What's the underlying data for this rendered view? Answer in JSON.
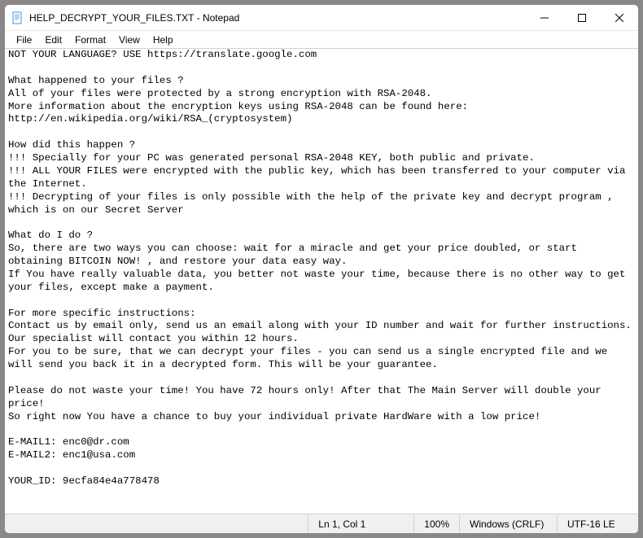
{
  "titlebar": {
    "title": "HELP_DECRYPT_YOUR_FILES.TXT - Notepad"
  },
  "menubar": {
    "items": [
      "File",
      "Edit",
      "Format",
      "View",
      "Help"
    ]
  },
  "content": {
    "text": "NOT YOUR LANGUAGE? USE https://translate.google.com\n\nWhat happened to your files ?\nAll of your files were protected by a strong encryption with RSA-2048.\nMore information about the encryption keys using RSA-2048 can be found here: http://en.wikipedia.org/wiki/RSA_(cryptosystem)\n\nHow did this happen ?\n!!! Specially for your PC was generated personal RSA-2048 KEY, both public and private.\n!!! ALL YOUR FILES were encrypted with the public key, which has been transferred to your computer via the Internet.\n!!! Decrypting of your files is only possible with the help of the private key and decrypt program , which is on our Secret Server\n\nWhat do I do ?\nSo, there are two ways you can choose: wait for a miracle and get your price doubled, or start obtaining BITCOIN NOW! , and restore your data easy way.\nIf You have really valuable data, you better not waste your time, because there is no other way to get your files, except make a payment.\n\nFor more specific instructions:\nContact us by email only, send us an email along with your ID number and wait for further instructions. Our specialist will contact you within 12 hours.\nFor you to be sure, that we can decrypt your files - you can send us a single encrypted file and we will send you back it in a decrypted form. This will be your guarantee.\n\nPlease do not waste your time! You have 72 hours only! After that The Main Server will double your price!\nSo right now You have a chance to buy your individual private HardWare with a low price!\n\nE-MAIL1: enc0@dr.com\nE-MAIL2: enc1@usa.com\n\nYOUR_ID: 9ecfa84e4a778478"
  },
  "statusbar": {
    "position": "Ln 1, Col 1",
    "zoom": "100%",
    "lineending": "Windows (CRLF)",
    "encoding": "UTF-16 LE"
  }
}
